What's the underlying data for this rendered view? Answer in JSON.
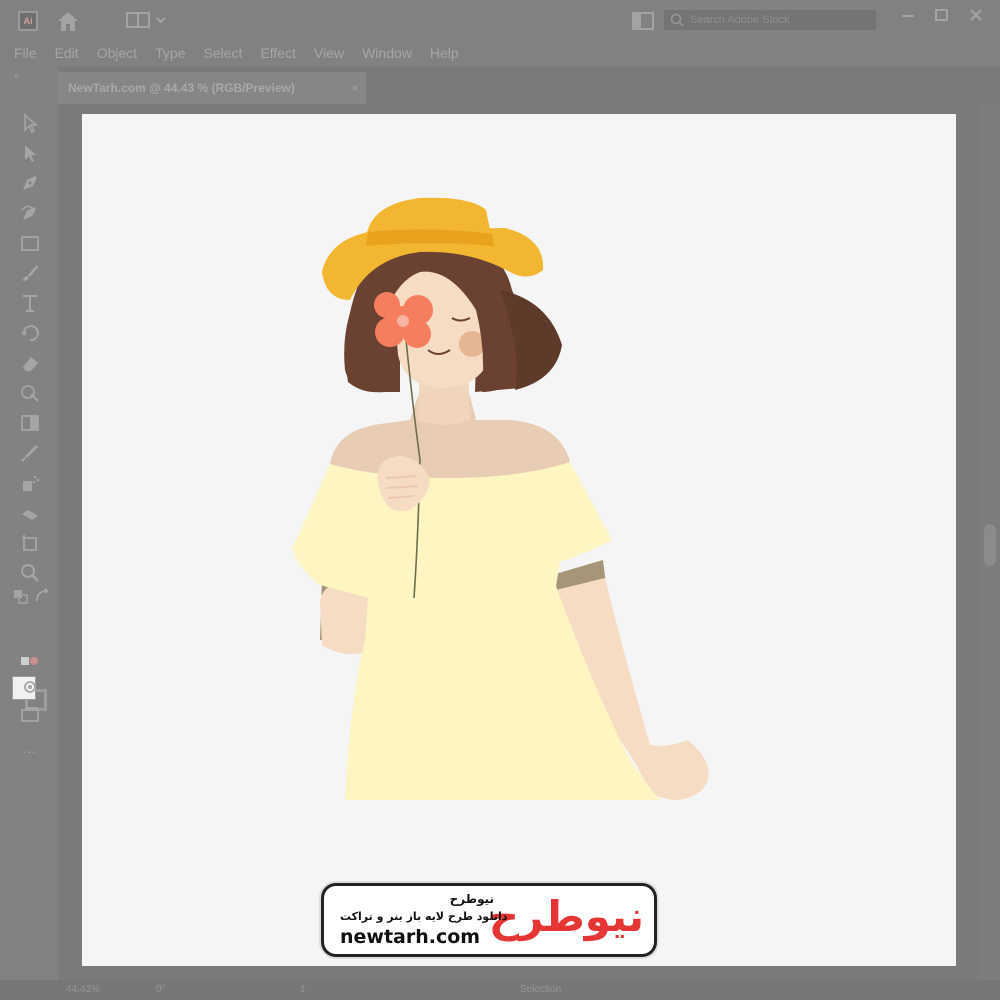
{
  "app": {
    "logo_text": "Ai",
    "icons": {
      "home": "home-icon",
      "workspace": "workspace-switcher-icon",
      "arrange": "arrange-documents-icon",
      "search": "search-icon",
      "minimize": "minimize-icon",
      "maximize": "maximize-icon",
      "close": "close-icon"
    }
  },
  "search": {
    "placeholder": "Search Adobe Stock"
  },
  "menu": [
    "File",
    "Edit",
    "Object",
    "Type",
    "Select",
    "Effect",
    "View",
    "Window",
    "Help"
  ],
  "document_tab": {
    "label": "NewTarh.com @ 44.43 % (RGB/Preview)",
    "close_label": "×"
  },
  "toolbar": {
    "collapse_label": "«",
    "tools": [
      "selection-tool-icon",
      "direct-selection-tool-icon",
      "pen-tool-icon",
      "curvature-tool-icon",
      "rectangle-tool-icon",
      "paintbrush-tool-icon",
      "type-tool-icon",
      "rotate-tool-icon",
      "eraser-tool-icon",
      "shape-builder-tool-icon",
      "gradient-tool-icon",
      "eyedropper-tool-icon",
      "symbol-sprayer-tool-icon",
      "column-graph-tool-icon",
      "artboard-tool-icon",
      "zoom-tool-icon",
      "draw-mode-icon",
      "screen-mode-icon",
      "more-tools-icon"
    ],
    "more_label": "..."
  },
  "status": {
    "zoom": "44.43%",
    "rotation": "0°",
    "artboard_nav": "1",
    "tool": "Selection"
  },
  "illustration": {
    "colors": {
      "hat": "#f2b630",
      "hat_band": "#e9a21e",
      "hair": "#6b4232",
      "skin": "#f5dcc3",
      "cheek": "#e5b694",
      "flower": "#f47e5e",
      "flower_center": "#f9b3a1",
      "dress": "#fdf5c2",
      "stem": "#6e6e4e"
    }
  },
  "watermark": {
    "logo_text": "نیوطرح",
    "brand_name": "نیوطرح",
    "tagline": "دانلود طرح لایه باز بنر و تراکت",
    "url": "newtarh.com",
    "colors": {
      "logo": "#e53535",
      "text": "#111111"
    }
  }
}
